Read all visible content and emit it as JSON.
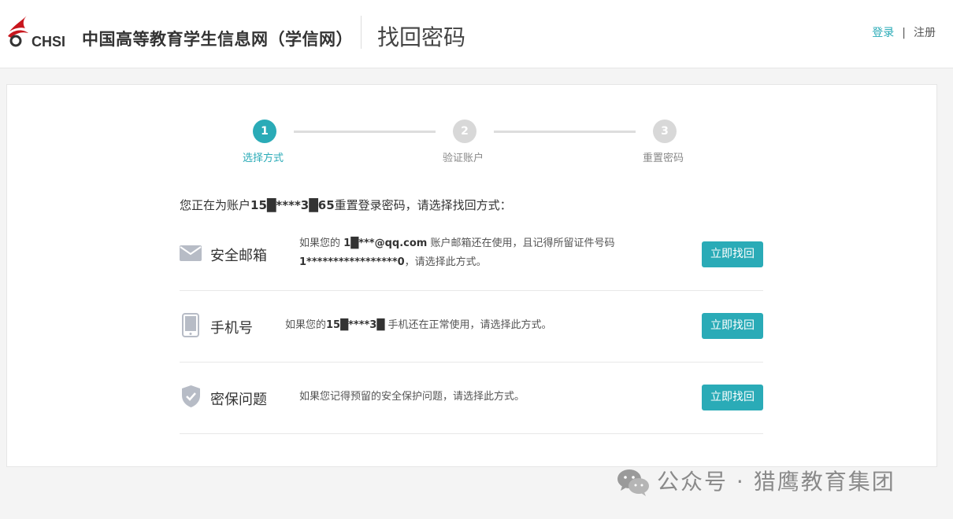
{
  "header": {
    "logo_text": "CHSI",
    "site_name": "中国高等教育学生信息网（学信网）",
    "page_title": "找回密码",
    "login": "登录",
    "separator": "|",
    "register": "注册"
  },
  "steps": [
    {
      "num": "1",
      "label": "选择方式",
      "state": "active"
    },
    {
      "num": "2",
      "label": "验证账户",
      "state": "inactive"
    },
    {
      "num": "3",
      "label": "重置密码",
      "state": "inactive"
    }
  ],
  "intro": {
    "prefix": "您正在为账户",
    "account_masked": "15█****3█65",
    "suffix": "重置登录密码，请选择找回方式："
  },
  "methods": [
    {
      "icon": "envelope-icon",
      "name": "安全邮箱",
      "desc_line1_prefix": "如果您的",
      "email": "1█***@qq.com",
      "desc_line1_suffix": "账户邮箱还在使用，且记得所留证件号码",
      "id_masked": "1*****************0",
      "desc_line2_suffix": "，请选择此方式。",
      "button": "立即找回"
    },
    {
      "icon": "mobile-phone-icon",
      "name": "手机号",
      "desc_prefix": "如果您的",
      "phone_masked": "15█****3█",
      "desc_suffix": "手机还在正常使用，请选择此方式。",
      "button": "立即找回"
    },
    {
      "icon": "shield-check-icon",
      "name": "密保问题",
      "desc": "如果您记得预留的安全保护问题，请选择此方式。",
      "button": "立即找回"
    }
  ],
  "watermark": {
    "icon": "wechat-icon",
    "text": "公众号 · 猎鹰教育集团"
  },
  "colors": {
    "accent": "#2aabb7",
    "step_inactive": "#d8d8d8",
    "logo_red": "#c8161d"
  }
}
